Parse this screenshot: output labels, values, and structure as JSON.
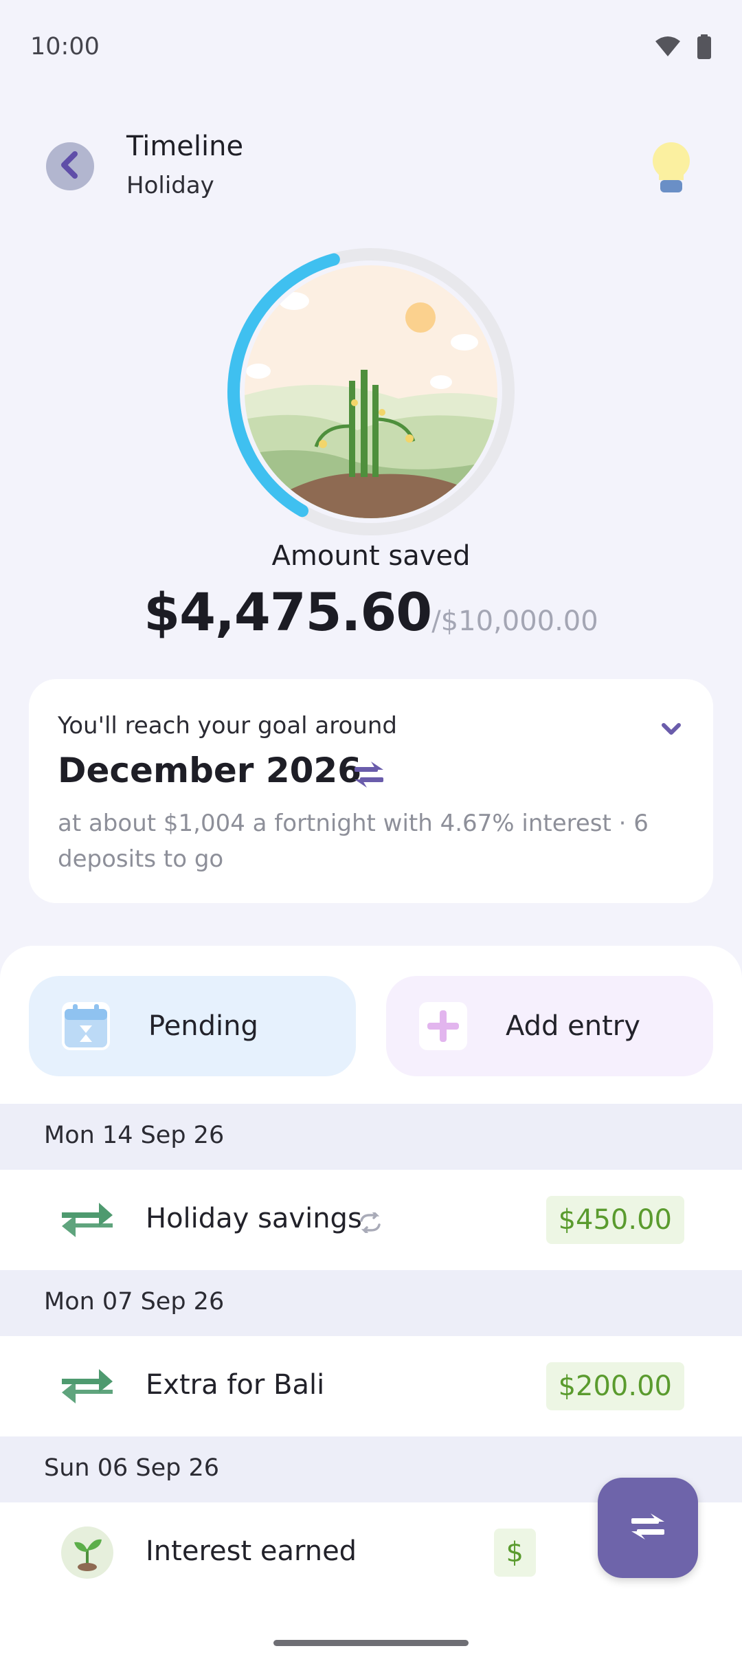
{
  "status_bar": {
    "time": "10:00",
    "icons": [
      "wifi-icon",
      "battery-icon"
    ]
  },
  "header": {
    "title": "Timeline",
    "subtitle": "Holiday",
    "back_icon": "chevron-left-icon",
    "tips_icon": "lightbulb-icon"
  },
  "progress": {
    "fraction": 0.4476,
    "ring_color": "#3fc0f0",
    "track_color": "#e8e8ec"
  },
  "summary": {
    "label": "Amount saved",
    "saved": "$4,475.60",
    "goal": "/$10,000.00"
  },
  "goal_card": {
    "intro": "You'll reach your goal around",
    "date": "December 2026",
    "detail": "at about $1,004 a fortnight with 4.67% interest · 6 deposits to go"
  },
  "actions": {
    "pending_label": "Pending",
    "add_entry_label": "Add entry"
  },
  "timeline": [
    {
      "date": "Mon 14 Sep 26",
      "entries": [
        {
          "icon": "transfer-icon",
          "label": "Holiday savings",
          "recurring": true,
          "amount": "$450.00"
        }
      ]
    },
    {
      "date": "Mon 07 Sep 26",
      "entries": [
        {
          "icon": "transfer-icon",
          "label": "Extra for Bali",
          "recurring": false,
          "amount": "$200.00"
        }
      ]
    },
    {
      "date": "Sun 06 Sep 26",
      "entries": [
        {
          "icon": "sprout-icon",
          "label": "Interest earned",
          "recurring": false,
          "amount": "$"
        }
      ]
    }
  ],
  "colors": {
    "accent": "#6e64aa",
    "positive": "#5a9b2e",
    "transfer_icon": "#4e9a6f"
  }
}
